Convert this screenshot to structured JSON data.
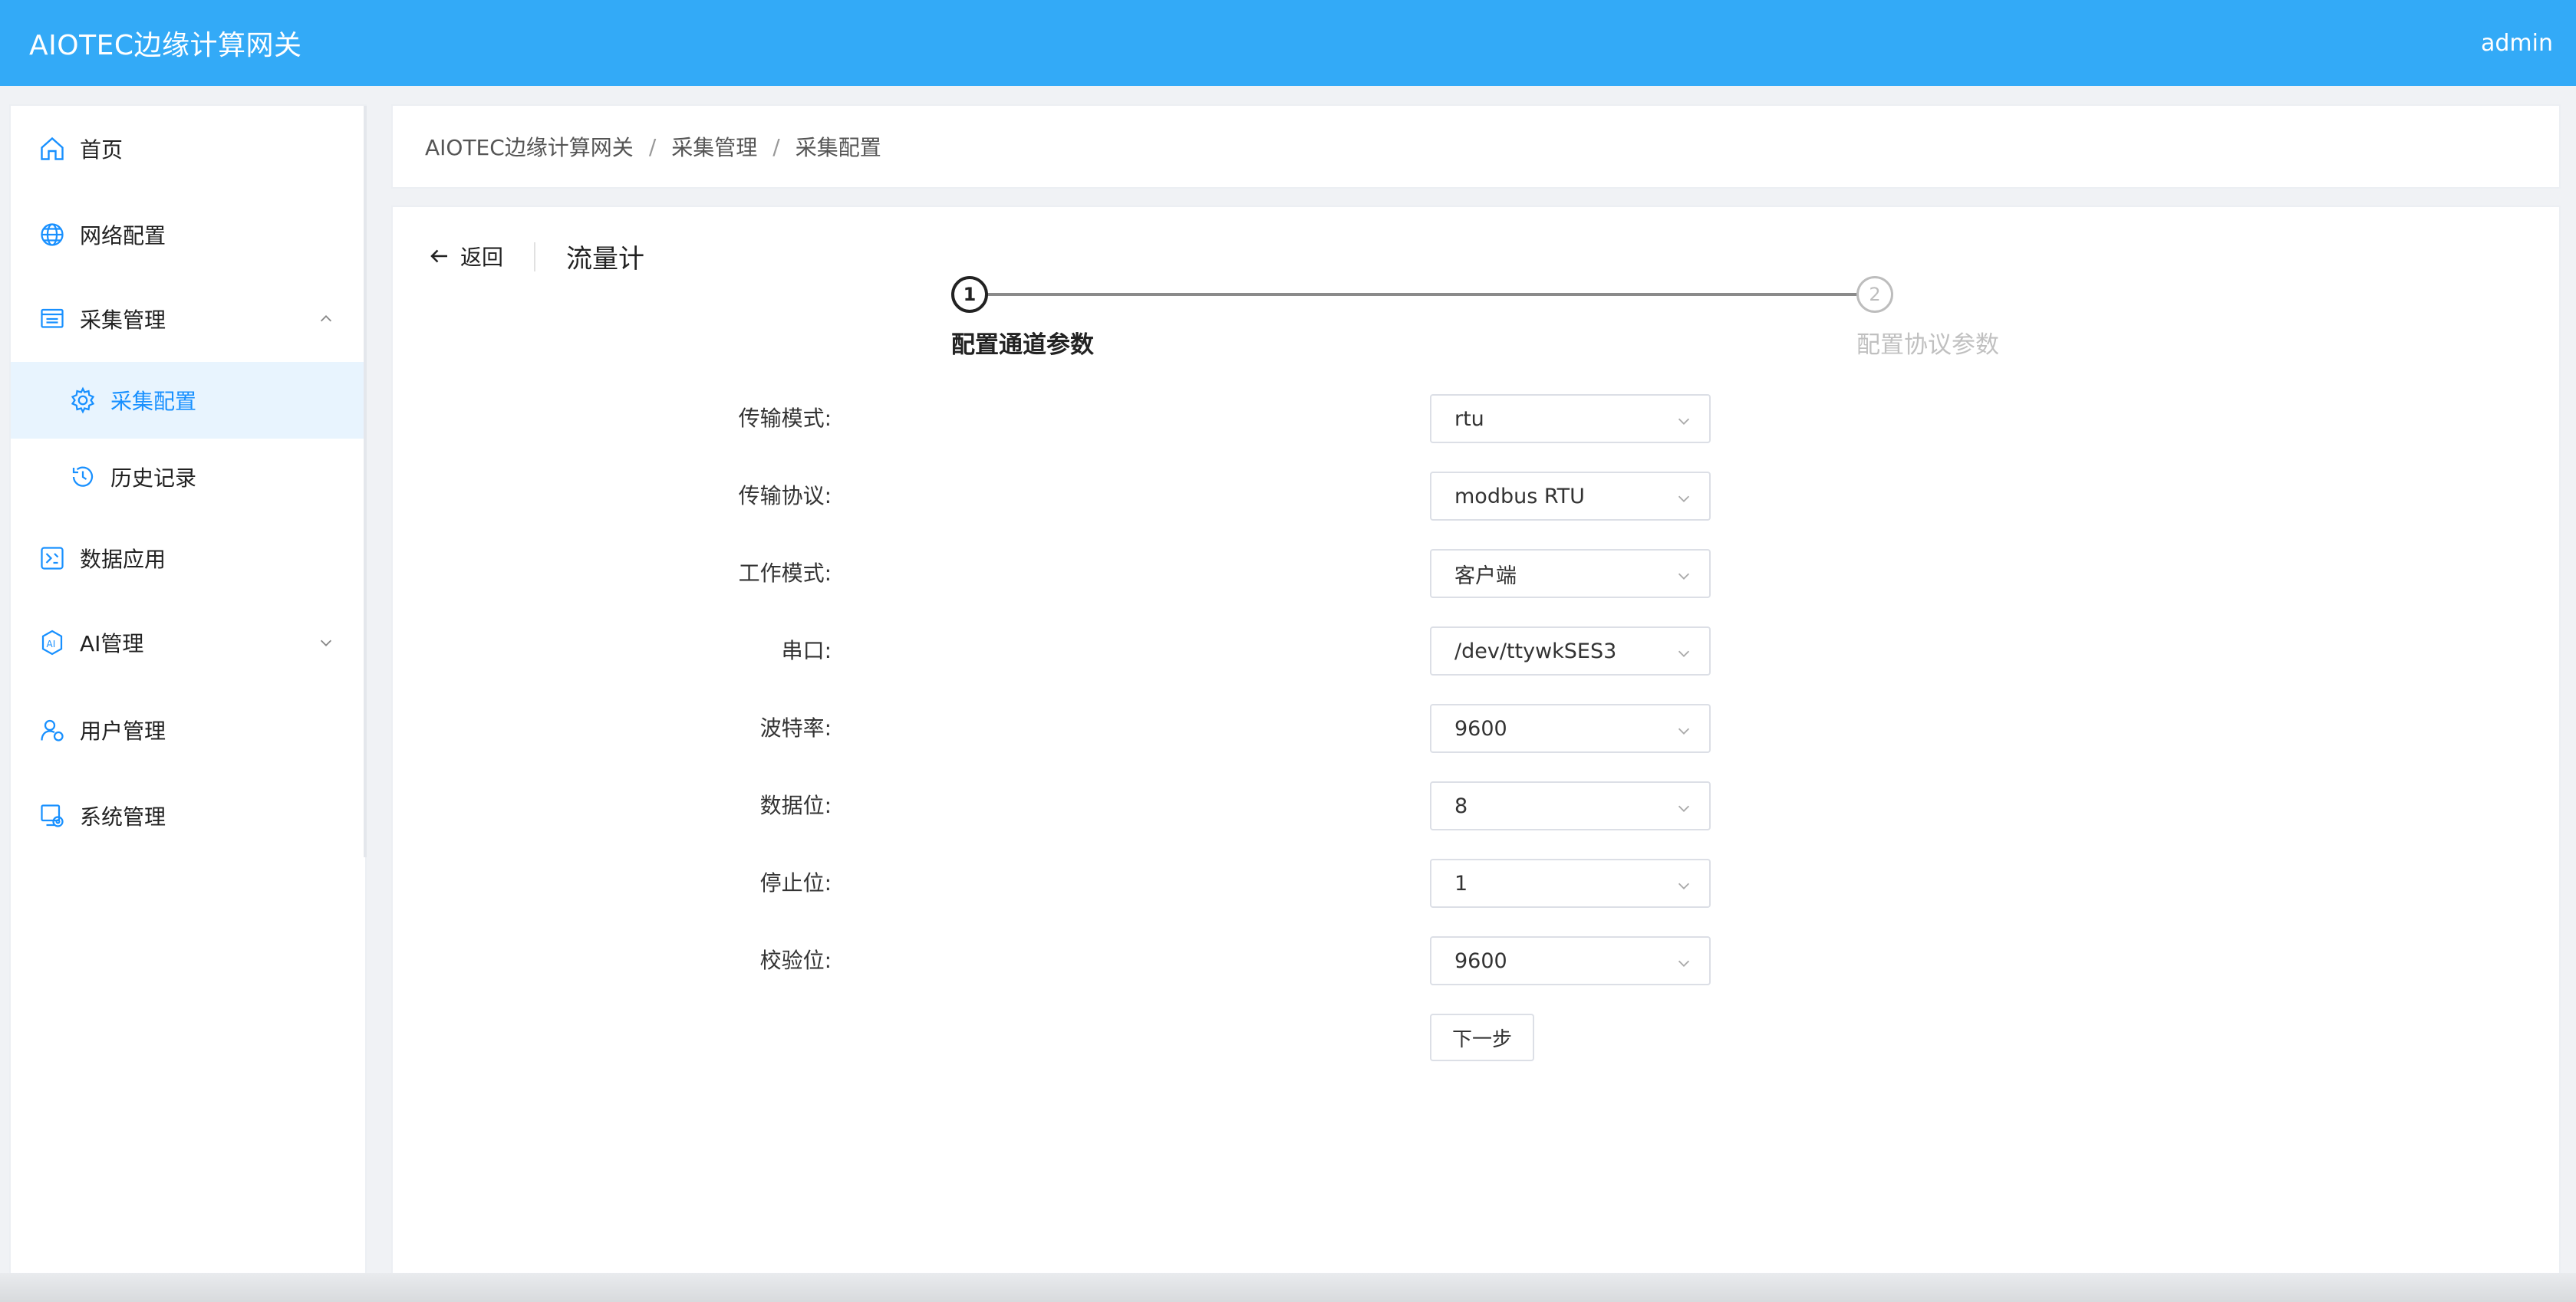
{
  "header": {
    "title": "AIOTEC边缘计算网关",
    "user": "admin"
  },
  "sidebar": {
    "items": [
      {
        "label": "首页",
        "icon": "home-icon"
      },
      {
        "label": "网络配置",
        "icon": "globe-icon"
      },
      {
        "label": "采集管理",
        "icon": "collection-icon",
        "expanded": true
      },
      {
        "label": "采集配置",
        "icon": "gear-icon",
        "active": true
      },
      {
        "label": "历史记录",
        "icon": "history-icon"
      },
      {
        "label": "数据应用",
        "icon": "data-app-icon"
      },
      {
        "label": "AI管理",
        "icon": "ai-icon",
        "expanded": false
      },
      {
        "label": "用户管理",
        "icon": "user-icon"
      },
      {
        "label": "系统管理",
        "icon": "system-icon"
      }
    ]
  },
  "breadcrumb": {
    "items": [
      "AIOTEC边缘计算网关",
      "采集管理",
      "采集配置"
    ],
    "separator": "/"
  },
  "page": {
    "back_label": "返回",
    "title": "流量计"
  },
  "steps": [
    {
      "number": "1",
      "label": "配置通道参数",
      "status": "active"
    },
    {
      "number": "2",
      "label": "配置协议参数",
      "status": "pending"
    }
  ],
  "form": {
    "fields": [
      {
        "label": "传输模式:",
        "value": "rtu"
      },
      {
        "label": "传输协议:",
        "value": "modbus RTU"
      },
      {
        "label": "工作模式:",
        "value": "客户端"
      },
      {
        "label": "串口:",
        "value": "/dev/ttywkSES3"
      },
      {
        "label": "波特率:",
        "value": "9600"
      },
      {
        "label": "数据位:",
        "value": "8"
      },
      {
        "label": "停止位:",
        "value": "1"
      },
      {
        "label": "校验位:",
        "value": "9600"
      }
    ],
    "next_label": "下一步"
  },
  "colors": {
    "header_bg": "#33aaf7",
    "accent": "#1890ff",
    "active_bg": "#e8f4fe"
  }
}
